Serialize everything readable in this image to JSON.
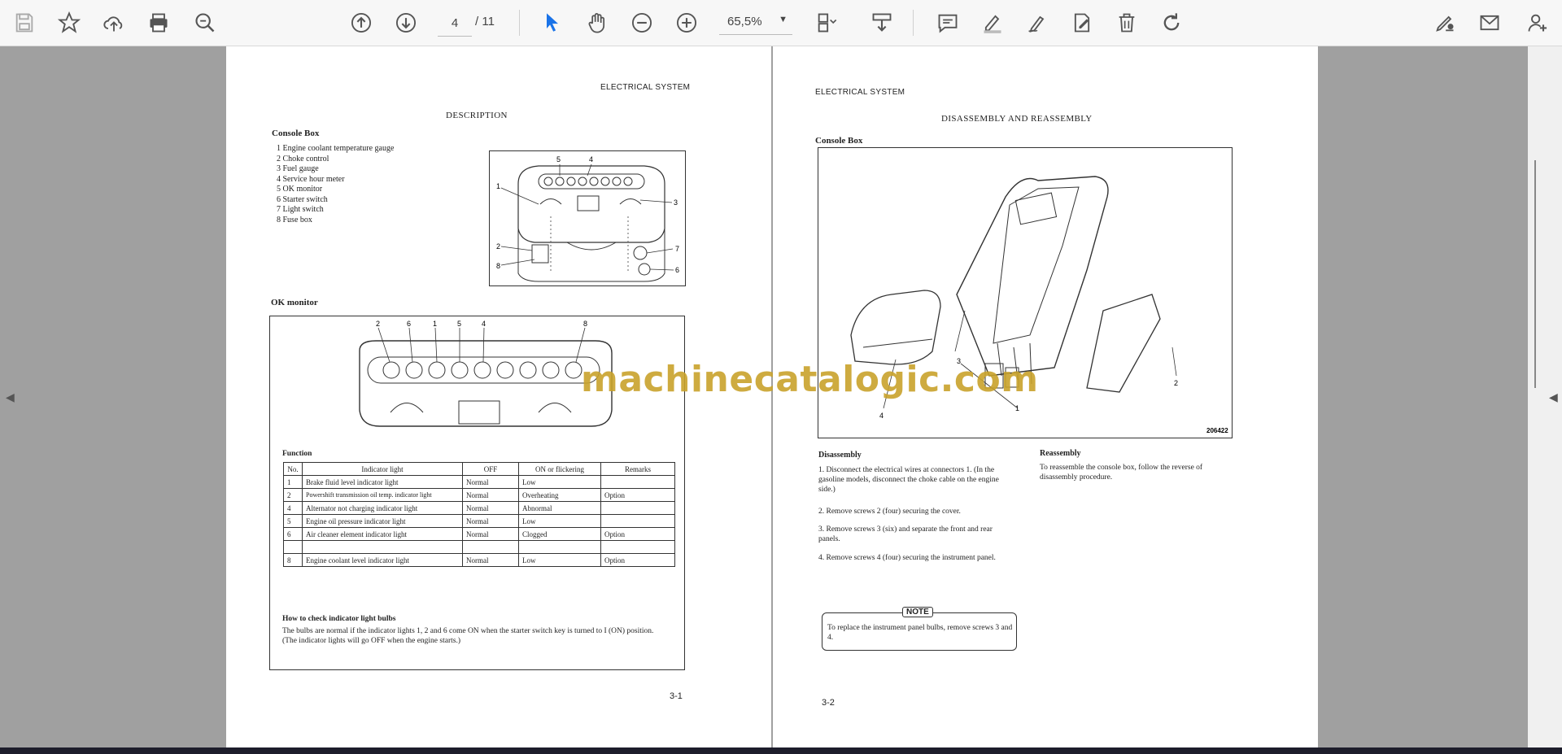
{
  "toolbar": {
    "current_page": "4",
    "page_count": "/ 11",
    "zoom": "65,5%"
  },
  "icons": [
    "save-icon",
    "bookmark-star-icon",
    "upload-cloud-icon",
    "print-icon",
    "zoom-search-icon",
    "page-up-icon",
    "page-down-icon",
    "zoom-out-icon",
    "zoom-in-icon",
    "select-cursor-icon",
    "hand-tool-icon",
    "page-view-icon",
    "download-tray-icon",
    "comment-icon",
    "highlight-pen-icon",
    "draw-pen-icon",
    "edit-doc-icon",
    "delete-icon",
    "redo-icon",
    "sign-icon",
    "mail-icon",
    "add-user-icon"
  ],
  "left_page": {
    "header": "ELECTRICAL SYSTEM",
    "title": "DESCRIPTION",
    "console_box_heading": "Console Box",
    "console_items": [
      "1  Engine coolant temperature gauge",
      "2  Choke control",
      "3  Fuel gauge",
      "4  Service hour meter",
      "5  OK monitor",
      "6  Starter switch",
      "7  Light switch",
      "8  Fuse box"
    ],
    "ok_monitor_heading": "OK monitor",
    "diagram_callouts_top": [
      "1",
      "5",
      "4",
      "3",
      "2",
      "8",
      "7",
      "6"
    ],
    "diagram_callouts_monitor": [
      "2",
      "6",
      "1",
      "5",
      "4",
      "8"
    ],
    "function_label": "Function",
    "table": {
      "headers": [
        "No.",
        "Indicator light",
        "OFF",
        "ON or flickering",
        "Remarks"
      ],
      "rows": [
        [
          "1",
          "Brake fluid level indicator light",
          "Normal",
          "Low",
          ""
        ],
        [
          "2",
          "Powershift transmission oil temp. indicator light",
          "Normal",
          "Overheating",
          "Option"
        ],
        [
          "4",
          "Alternator not charging indicator light",
          "Normal",
          "Abnormal",
          ""
        ],
        [
          "5",
          "Engine oil pressure indicator light",
          "Normal",
          "Low",
          ""
        ],
        [
          "6",
          "Air cleaner element indicator light",
          "Normal",
          "Clogged",
          "Option"
        ],
        [
          "",
          "",
          "",
          "",
          ""
        ],
        [
          "8",
          "Engine coolant level indicator light",
          "Normal",
          "Low",
          "Option"
        ]
      ]
    },
    "check_heading": "How to check indicator light bulbs",
    "check_text": "The bulbs are normal if the indicator lights 1, 2    and 6 come ON when the starter switch key is turned to I (ON) position.  (The indicator lights will go OFF when the engine starts.)",
    "page_number": "3-1"
  },
  "right_page": {
    "header": "ELECTRICAL SYSTEM",
    "title": "DISASSEMBLY AND REASSEMBLY",
    "console_box_heading": "Console Box",
    "figure_callouts": [
      "3",
      "4",
      "1",
      "2"
    ],
    "figure_id": "206422",
    "disassembly_heading": "Disassembly",
    "disassembly_steps": [
      "1.  Disconnect the electrical wires at connectors 1. (In the gasoline models, disconnect the choke cable on the engine side.)",
      "2.  Remove screws 2 (four) securing the cover.",
      "3.  Remove screws 3 (six) and separate the front and rear panels.",
      "4.  Remove screws 4 (four) securing the instrument panel."
    ],
    "reassembly_heading": "Reassembly",
    "reassembly_text": "To reassemble the console box, follow the reverse of disassembly procedure.",
    "note_label": "NOTE",
    "note_text": "To replace the instrument panel bulbs, remove screws 3 and 4.",
    "page_number": "3-2"
  },
  "watermark": "machinecatalogic.com",
  "colors": {
    "toolbar_bg": "#f7f7f7",
    "viewer_bg": "#a0a0a0",
    "accent_blue": "#1a73e8",
    "watermark": "#c9a32c"
  }
}
